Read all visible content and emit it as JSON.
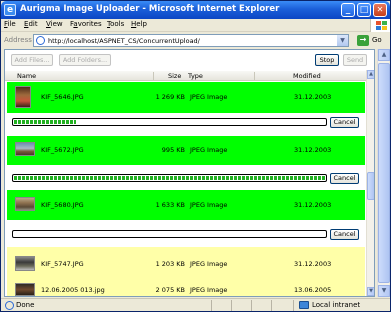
{
  "window": {
    "title": "Aurigma Image Uploader - Microsoft Internet Explorer",
    "app_icon_glyph": "e",
    "minimize_glyph": "_",
    "maximize_glyph": "□",
    "close_glyph": "✕"
  },
  "menu": {
    "items": [
      {
        "accel": "F",
        "rest": "ile"
      },
      {
        "accel": "E",
        "rest": "dit"
      },
      {
        "accel": "V",
        "rest": "iew"
      },
      {
        "pre": "F",
        "accel": "a",
        "rest": "vorites"
      },
      {
        "accel": "T",
        "rest": "ools"
      },
      {
        "accel": "H",
        "rest": "elp"
      }
    ]
  },
  "address": {
    "label": "Address",
    "url": "http://localhost/ASPNET_CS/ConcurrentUpload/",
    "dropdown_glyph": "▼",
    "go_glyph": "→",
    "go_label": "Go"
  },
  "toolbar": {
    "add_files": "Add Files...",
    "add_folders": "Add Folders...",
    "stop": "Stop",
    "send": "Send"
  },
  "columns": {
    "name": "Name",
    "size": "Size",
    "type": "Type",
    "modified": "Modified"
  },
  "files": [
    {
      "name": "KIF_5646.JPG",
      "size": "1 269 KB",
      "type": "JPEG Image",
      "modified": "31.12.2003",
      "status": "uploading",
      "progress": 0.2,
      "row_color": "#00ff00"
    },
    {
      "name": "KIF_5672.JPG",
      "size": "995 KB",
      "type": "JPEG Image",
      "modified": "31.12.2003",
      "status": "uploading",
      "progress": 1.0,
      "row_color": "#00ff00"
    },
    {
      "name": "KIF_5680.JPG",
      "size": "1 633 KB",
      "type": "JPEG Image",
      "modified": "31.12.2003",
      "status": "uploading",
      "progress": 0.0,
      "row_color": "#00ff00"
    },
    {
      "name": "KIF_5747.JPG",
      "size": "1 203 KB",
      "type": "JPEG Image",
      "modified": "31.12.2003",
      "status": "queued",
      "row_color": "#ffffa8"
    },
    {
      "name": "12.06.2005 013.jpg",
      "size": "2 075 KB",
      "type": "JPEG Image",
      "modified": "13.06.2005",
      "status": "queued",
      "row_color": "#ffffa8"
    }
  ],
  "cancel_label": "Cancel",
  "status": {
    "text": "Done",
    "zone": "Local intranet"
  }
}
